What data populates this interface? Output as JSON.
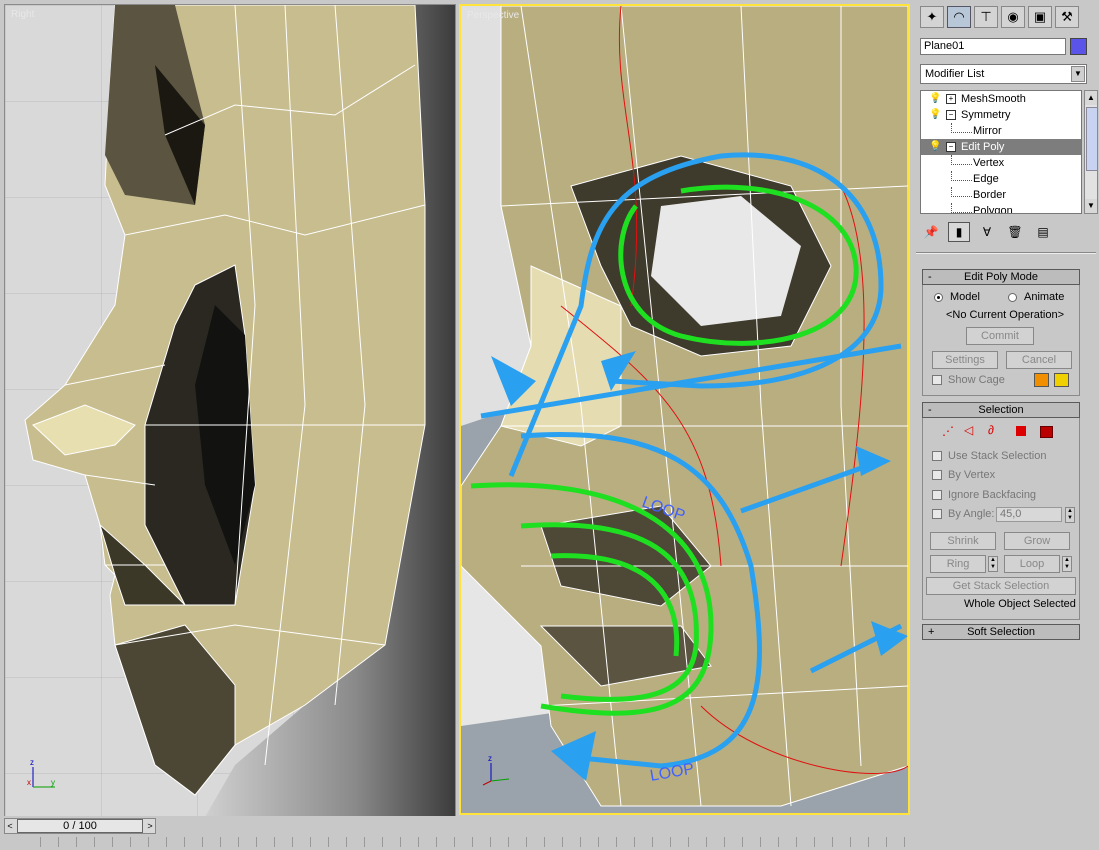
{
  "viewports": {
    "left": {
      "label": "Right"
    },
    "right": {
      "label": "Perspective",
      "annotations": [
        "LOOP",
        "LOOP"
      ]
    }
  },
  "panel": {
    "tabs": [
      {
        "name": "create-tab",
        "glyph": "✦"
      },
      {
        "name": "modify-tab",
        "glyph": "◠"
      },
      {
        "name": "hierarchy-tab",
        "glyph": "⊤"
      },
      {
        "name": "motion-tab",
        "glyph": "◉"
      },
      {
        "name": "display-tab",
        "glyph": "▣"
      },
      {
        "name": "utilities-tab",
        "glyph": "⚒"
      }
    ],
    "object_name": "Plane01",
    "object_color": "#5a55e8",
    "modifier_list": "Modifier List",
    "stack": [
      {
        "label": "MeshSmooth",
        "box": "+"
      },
      {
        "label": "Symmetry",
        "box": "−"
      },
      {
        "label": "Mirror"
      },
      {
        "label": "Edit Poly",
        "box": "−",
        "selected": true
      },
      {
        "label": "Vertex"
      },
      {
        "label": "Edge"
      },
      {
        "label": "Border"
      },
      {
        "label": "Polygon"
      }
    ],
    "edit_poly_mode": {
      "title": "Edit Poly Mode",
      "model": "Model",
      "animate": "Animate",
      "status": "<No Current Operation>",
      "commit": "Commit",
      "settings": "Settings",
      "cancel": "Cancel",
      "show_cage": "Show Cage",
      "cage_colors": [
        "#f09000",
        "#f0d000"
      ]
    },
    "selection": {
      "title": "Selection",
      "use_stack": "Use Stack Selection",
      "by_vertex": "By Vertex",
      "ignore_backfacing": "Ignore Backfacing",
      "by_angle": "By Angle:",
      "angle_value": "45,0",
      "shrink": "Shrink",
      "grow": "Grow",
      "ring": "Ring",
      "loop": "Loop",
      "get_stack": "Get Stack Selection",
      "status": "Whole Object Selected"
    },
    "soft_selection": {
      "title": "Soft Selection"
    }
  },
  "timeline": {
    "frame": "0 / 100"
  }
}
